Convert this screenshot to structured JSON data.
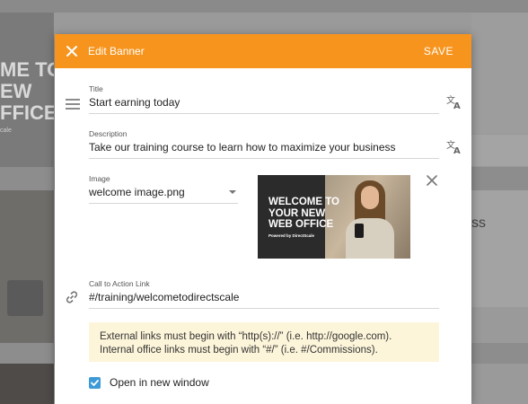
{
  "background": {
    "card1_text": "ME TO\nEW\nFFICE",
    "card1_small": "cale",
    "right_text": "ss"
  },
  "dialog": {
    "title": "Edit Banner",
    "save_label": "SAVE",
    "header_color": "#f7941d",
    "icons": {
      "close": "close-icon",
      "menu": "menu-icon",
      "translate": "translate-icon",
      "remove": "close-icon",
      "link": "link-icon"
    },
    "fields": {
      "title": {
        "label": "Title",
        "value": "Start earning today"
      },
      "description": {
        "label": "Description",
        "value": "Take our training course to learn how to maximize your business"
      },
      "image": {
        "label": "Image",
        "value": "welcome image.png"
      },
      "cta_link": {
        "label": "Call to Action Link",
        "value": "#/training/welcometodirectscale"
      }
    },
    "preview": {
      "headline_line1": "WELCOME TO",
      "headline_line2": "YOUR NEW",
      "headline_line3": "WEB OFFICE",
      "powered": "Powered by DirectScale"
    },
    "note": {
      "line1": "External links must begin with “http(s)://” (i.e. http://google.com).",
      "line2": "Internal  office links must begin with “#/” (i.e. #/Commissions)."
    },
    "open_new_window": {
      "label": "Open in new window",
      "checked": true,
      "color": "#3d9ad6"
    }
  }
}
